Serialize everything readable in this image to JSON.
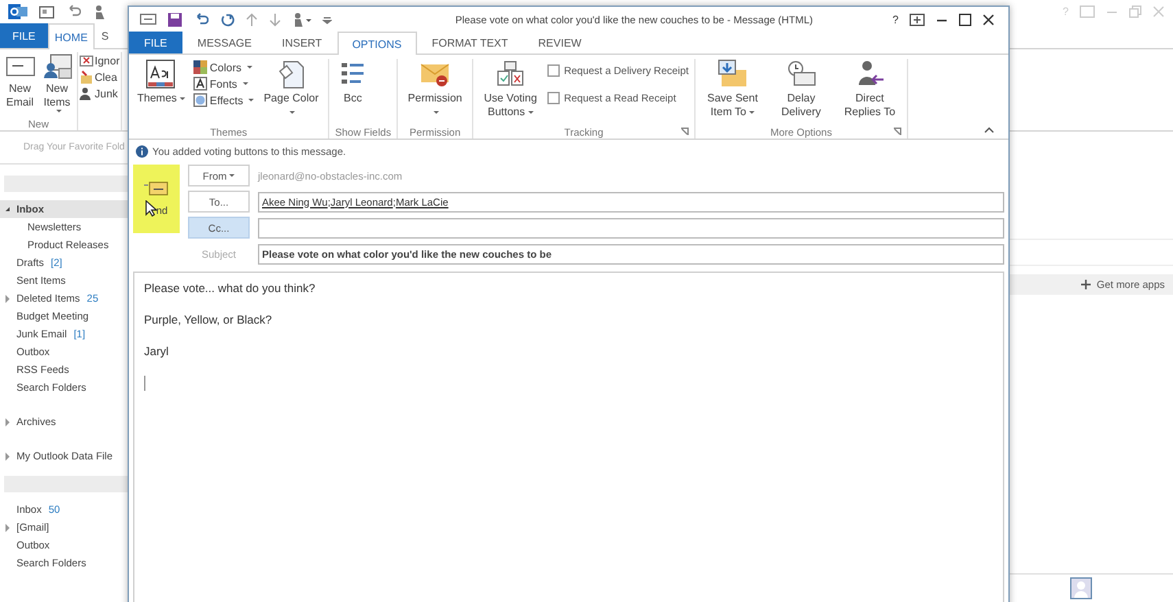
{
  "main_window": {
    "help": "?",
    "tabs": [
      {
        "label": "FILE",
        "kind": "file",
        "selected": false
      },
      {
        "label": "HOME",
        "kind": "tab",
        "selected": true
      },
      {
        "label": "S",
        "kind": "tab",
        "selected": false
      }
    ],
    "ribbon": {
      "groups": [
        {
          "label": "New",
          "items": [
            {
              "label": "New Email",
              "kind": "large",
              "dropdown": false
            },
            {
              "label": "New Items",
              "kind": "large",
              "dropdown": true
            }
          ]
        },
        {
          "items": [
            {
              "label": "Ignor",
              "kind": "small",
              "dropdown": false
            },
            {
              "label": "Clea",
              "kind": "small",
              "dropdown": false
            },
            {
              "label": "Junk",
              "kind": "small",
              "dropdown": false
            }
          ]
        }
      ]
    },
    "favorites_hint": "Drag Your Favorite Fold",
    "accounts": [
      {
        "folders": [
          {
            "label": "Inbox",
            "selected": true,
            "expanded": true,
            "children": [
              {
                "label": "Newsletters",
                "selected": false
              },
              {
                "label": "Product Releases",
                "selected": false
              }
            ]
          },
          {
            "label": "Drafts",
            "count": "[2]",
            "selected": false
          },
          {
            "label": "Sent Items",
            "selected": false
          },
          {
            "label": "Deleted Items",
            "count": "25",
            "selected": false,
            "expanded": false
          },
          {
            "label": "Budget Meeting",
            "selected": false
          },
          {
            "label": "Junk Email",
            "count": "[1]",
            "selected": false
          },
          {
            "label": "Outbox",
            "selected": false
          },
          {
            "label": "RSS Feeds",
            "selected": false
          },
          {
            "label": "Search Folders",
            "selected": false
          }
        ]
      },
      {
        "folders": [
          {
            "label": "Archives",
            "selected": false,
            "expanded": false
          }
        ]
      },
      {
        "folders": [
          {
            "label": "My Outlook Data File",
            "selected": false,
            "expanded": false
          }
        ]
      },
      {
        "folders": [
          {
            "label": "Inbox",
            "count": "50",
            "selected": false
          },
          {
            "label": "[Gmail]",
            "selected": false,
            "expanded": false
          },
          {
            "label": "Outbox",
            "selected": false
          },
          {
            "label": "Search Folders",
            "selected": false
          }
        ]
      }
    ],
    "side_panel": {
      "action": "Get more apps"
    }
  },
  "message_window": {
    "help": "?",
    "title": "Please vote on what color you'd like the new couches to be - Message (HTML)",
    "tabs": [
      {
        "label": "FILE",
        "kind": "file",
        "selected": false
      },
      {
        "label": "MESSAGE",
        "kind": "tab",
        "selected": false
      },
      {
        "label": "INSERT",
        "kind": "tab",
        "selected": false
      },
      {
        "label": "OPTIONS",
        "kind": "tab",
        "selected": true
      },
      {
        "label": "FORMAT TEXT",
        "kind": "tab",
        "selected": false
      },
      {
        "label": "REVIEW",
        "kind": "tab",
        "selected": false
      }
    ],
    "ribbon": {
      "groups": [
        {
          "label": "Themes",
          "launcher": false,
          "items": [
            {
              "label": "Themes",
              "kind": "large",
              "dropdown": true
            },
            {
              "label": "Colors",
              "kind": "small",
              "dropdown": true
            },
            {
              "label": "Fonts",
              "kind": "small",
              "dropdown": true
            },
            {
              "label": "Effects",
              "kind": "small",
              "dropdown": true
            },
            {
              "label": "Page Color",
              "kind": "large",
              "dropdown": true
            }
          ]
        },
        {
          "label": "Show Fields",
          "launcher": false,
          "items": [
            {
              "label": "Bcc",
              "kind": "large",
              "dropdown": false
            }
          ]
        },
        {
          "label": "Permission",
          "launcher": false,
          "items": [
            {
              "label": "Permission",
              "kind": "large",
              "dropdown": true
            }
          ]
        },
        {
          "label": "Tracking",
          "launcher": true,
          "items": [
            {
              "label": "Use Voting Buttons",
              "kind": "large",
              "dropdown": true
            },
            {
              "label": "Request a Delivery Receipt",
              "kind": "checkbox",
              "checked": false
            },
            {
              "label": "Request a Read Receipt",
              "kind": "checkbox",
              "checked": false
            }
          ]
        },
        {
          "label": "More Options",
          "launcher": true,
          "items": [
            {
              "label": "Save Sent Item To",
              "kind": "large",
              "dropdown": true
            },
            {
              "label": "Delay Delivery",
              "kind": "large",
              "dropdown": false
            },
            {
              "label": "Direct Replies To",
              "kind": "large",
              "dropdown": false
            }
          ]
        }
      ]
    },
    "info_bar": "You added voting buttons to this message.",
    "send": {
      "label": "nd",
      "highlighted": true
    },
    "from": {
      "button": "From",
      "value": "jleonard@no-obstacles-inc.com"
    },
    "to": {
      "button": "To...",
      "recipients": [
        "Akee Ning Wu",
        "Jaryl Leonard",
        "Mark LaCie"
      ],
      "separator": ";"
    },
    "cc": {
      "button": "Cc...",
      "selected": true
    },
    "subject": {
      "label": "Subject",
      "value": "Please vote on what color you'd like the new couches to be"
    },
    "body": [
      "Please vote... what do you think?",
      "Purple, Yellow, or Black?",
      "Jaryl"
    ]
  }
}
